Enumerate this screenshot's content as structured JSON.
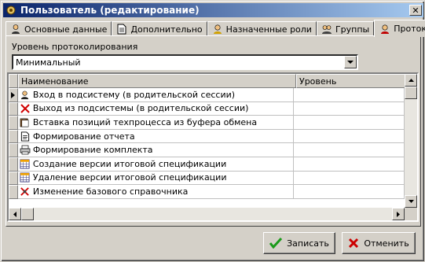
{
  "window": {
    "title": "Пользователь (редактирование)",
    "close_label": "✕"
  },
  "tabs": [
    {
      "label": "Основные данные",
      "icon": "user-icon"
    },
    {
      "label": "Дополнительно",
      "icon": "document-icon"
    },
    {
      "label": "Назначенные роли",
      "icon": "roles-icon"
    },
    {
      "label": "Группы",
      "icon": "groups-icon"
    },
    {
      "label": "Протокол",
      "icon": "protocol-icon",
      "active": true
    }
  ],
  "logging": {
    "label": "Уровень протоколирования",
    "value": "Минимальный"
  },
  "grid": {
    "columns": [
      "Наименование",
      "Уровень"
    ],
    "rows": [
      {
        "name": "Вход в подсистему (в родительской сессии)",
        "level": "",
        "icon": "login-icon",
        "current": true
      },
      {
        "name": "Выход из подсистемы (в родительской сессии)",
        "level": "",
        "icon": "red-x-icon"
      },
      {
        "name": "Вставка позиций техпроцесса из буфера обмена",
        "level": "",
        "icon": "clipboard-icon"
      },
      {
        "name": "Формирование отчета",
        "level": "",
        "icon": "report-icon"
      },
      {
        "name": "Формирование комплекта",
        "level": "",
        "icon": "printer-icon"
      },
      {
        "name": "Создание версии итоговой спецификации",
        "level": "",
        "icon": "spec-create-icon"
      },
      {
        "name": "Удаление версии итоговой спецификации",
        "level": "",
        "icon": "spec-delete-icon"
      },
      {
        "name": "Изменение базового справочника",
        "level": "",
        "icon": "reference-edit-icon"
      }
    ]
  },
  "buttons": {
    "save": "Записать",
    "cancel": "Отменить"
  },
  "colors": {
    "title_start": "#0a246a",
    "title_end": "#a6caf0",
    "face": "#d4d0c8",
    "save_check": "#1a9a1a",
    "cancel_x": "#cc0000"
  }
}
